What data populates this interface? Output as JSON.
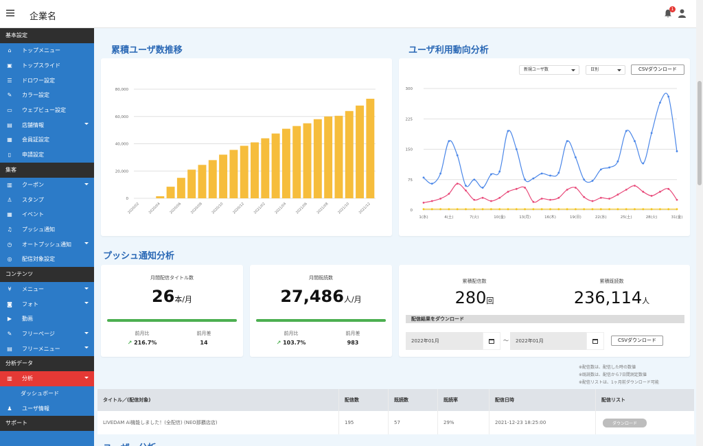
{
  "header": {
    "title": "企業名",
    "notification_count": "1"
  },
  "sidebar": {
    "sections": [
      {
        "title": "基本設定",
        "items": [
          {
            "label": "トップメニュー",
            "icon": "home-icon"
          },
          {
            "label": "トップスライド",
            "icon": "image-icon"
          },
          {
            "label": "ドロワー設定",
            "icon": "list-icon"
          },
          {
            "label": "カラー設定",
            "icon": "pen-icon"
          },
          {
            "label": "ウェブビュー設定",
            "icon": "window-icon"
          },
          {
            "label": "店舗情報",
            "icon": "store-icon",
            "caret": true
          },
          {
            "label": "会員証設定",
            "icon": "card-icon"
          },
          {
            "label": "申請設定",
            "icon": "doc-icon"
          }
        ]
      },
      {
        "title": "集客",
        "items": [
          {
            "label": "クーポン",
            "icon": "ticket-icon",
            "caret": true
          },
          {
            "label": "スタンプ",
            "icon": "stamp-icon"
          },
          {
            "label": "イベント",
            "icon": "calendar-icon"
          },
          {
            "label": "プッシュ通知",
            "icon": "bell-icon"
          },
          {
            "label": "オートプッシュ通知",
            "icon": "clock-icon",
            "caret": true
          },
          {
            "label": "配信対象設定",
            "icon": "target-icon"
          }
        ]
      },
      {
        "title": "コンテンツ",
        "items": [
          {
            "label": "メニュー",
            "icon": "cutlery-icon",
            "caret": true
          },
          {
            "label": "フォト",
            "icon": "camera-icon",
            "caret": true
          },
          {
            "label": "動画",
            "icon": "play-icon"
          },
          {
            "label": "フリーページ",
            "icon": "edit-icon",
            "caret": true
          },
          {
            "label": "フリーメニュー",
            "icon": "book-icon",
            "caret": true
          }
        ]
      },
      {
        "title": "分析データ",
        "items": [
          {
            "label": "分析",
            "icon": "chart-icon",
            "caret": true,
            "active": true
          },
          {
            "label": "ダッシュボード",
            "sub": true
          },
          {
            "label": "ユーザ情報",
            "icon": "user-icon"
          }
        ]
      },
      {
        "title": "サポート",
        "items": []
      }
    ]
  },
  "sections": {
    "cumulative_title": "累積ユーザ数推移",
    "trend_title": "ユーザ利用動向分析",
    "push_title": "プッシュ通知分析",
    "next_title": "ユーザー分析"
  },
  "trend_controls": {
    "dropdown1": "新規ユーザ数",
    "dropdown2": "日別",
    "csv_button": "CSVダウンロード"
  },
  "stats": {
    "monthly_titles": {
      "label": "月間配信タイトル数",
      "value": "26",
      "unit": "本/月",
      "prev_ratio_label": "前月比",
      "prev_ratio": "216.7%",
      "prev_diff_label": "前月差",
      "prev_diff": "14"
    },
    "monthly_opens": {
      "label": "月間既読数",
      "value": "27,486",
      "unit": "人/月",
      "prev_ratio_label": "前月比",
      "prev_ratio": "103.7%",
      "prev_diff_label": "前月差",
      "prev_diff": "983"
    },
    "total_sent": {
      "label": "累積配信数",
      "value": "280",
      "unit": "回"
    },
    "total_opens": {
      "label": "累積既読数",
      "value": "236,114",
      "unit": "人"
    }
  },
  "download": {
    "bar_label": "配信結果をダウンロード",
    "start_date": "2022年01月",
    "separator": "〜",
    "end_date": "2022年01月",
    "csv_button": "CSVダウンロード"
  },
  "notes": [
    "※配信数は、配信した時の数値",
    "※既読数は、配信から7日間測定数値",
    "※配信リストは、1ヶ月前ダウンロード可能"
  ],
  "table": {
    "headers": [
      "タイトル／(配信対象)",
      "配信数",
      "既読数",
      "既読率",
      "配信日時",
      "配信リスト"
    ],
    "rows": [
      [
        "LIVEDAM Ai機能しました！(全配信) (NEO那覇店店)",
        "195",
        "57",
        "29%",
        "2021-12-23 18:25:00",
        "ダウンロード"
      ]
    ]
  },
  "chart_data": [
    {
      "type": "bar",
      "categories": [
        "2020/02",
        "2020/03",
        "2020/04",
        "2020/05",
        "2020/06",
        "2020/07",
        "2020/08",
        "2020/09",
        "2020/10",
        "2020/11",
        "2020/12",
        "2021/01",
        "2021/02",
        "2021/03",
        "2021/04",
        "2021/05",
        "2021/06",
        "2021/07",
        "2021/08",
        "2021/09",
        "2021/10",
        "2021/11",
        "2021/12"
      ],
      "tick_labels": [
        "2020/02",
        "2020/04",
        "2020/06",
        "2020/08",
        "2020/10",
        "2020/12",
        "2021/02",
        "2021/04",
        "2021/06",
        "2021/08",
        "2021/10",
        "2021/12"
      ],
      "values": [
        0,
        0,
        1500,
        8500,
        15000,
        21000,
        24500,
        28000,
        32000,
        35500,
        38500,
        41000,
        44000,
        47500,
        51000,
        53000,
        55000,
        58000,
        60000,
        60500,
        64000,
        68000,
        73000
      ],
      "yticks": [
        "0",
        "20,000",
        "40,000",
        "60,000",
        "80,000"
      ],
      "ylim": [
        0,
        80000
      ],
      "color": "#f6bd3c"
    },
    {
      "type": "line",
      "x": [
        "1(水)",
        "2",
        "3",
        "4(土)",
        "5",
        "6",
        "7(火)",
        "8",
        "9",
        "10(金)",
        "11",
        "12",
        "13(月)",
        "14",
        "15",
        "16(木)",
        "17",
        "18",
        "19(日)",
        "20",
        "21",
        "22(水)",
        "23",
        "24",
        "25(土)",
        "26",
        "27",
        "28(火)",
        "29",
        "30",
        "31(金)"
      ],
      "tick_labels": [
        "1(水)",
        "4(土)",
        "7(火)",
        "10(金)",
        "13(月)",
        "16(木)",
        "19(日)",
        "22(水)",
        "25(土)",
        "28(火)",
        "31(金)"
      ],
      "yticks": [
        "0",
        "75",
        "150",
        "225",
        "300"
      ],
      "ylim": [
        0,
        300
      ],
      "series": [
        {
          "color": "#4a86e8",
          "values": [
            80,
            65,
            90,
            170,
            135,
            60,
            75,
            55,
            88,
            95,
            195,
            150,
            75,
            78,
            90,
            85,
            92,
            170,
            130,
            75,
            72,
            100,
            105,
            120,
            195,
            170,
            115,
            190,
            265,
            280,
            145
          ]
        },
        {
          "color": "#e84a7a",
          "values": [
            18,
            22,
            28,
            40,
            65,
            48,
            25,
            30,
            22,
            30,
            45,
            52,
            55,
            20,
            28,
            25,
            30,
            50,
            55,
            32,
            22,
            30,
            28,
            38,
            50,
            60,
            45,
            35,
            45,
            52,
            25
          ]
        },
        {
          "color": "#f5c518",
          "values": [
            2,
            2,
            2,
            2,
            2,
            2,
            2,
            2,
            2,
            2,
            2,
            2,
            2,
            2,
            2,
            2,
            2,
            2,
            2,
            2,
            2,
            2,
            2,
            2,
            2,
            2,
            2,
            2,
            2,
            2,
            2
          ]
        }
      ]
    }
  ]
}
